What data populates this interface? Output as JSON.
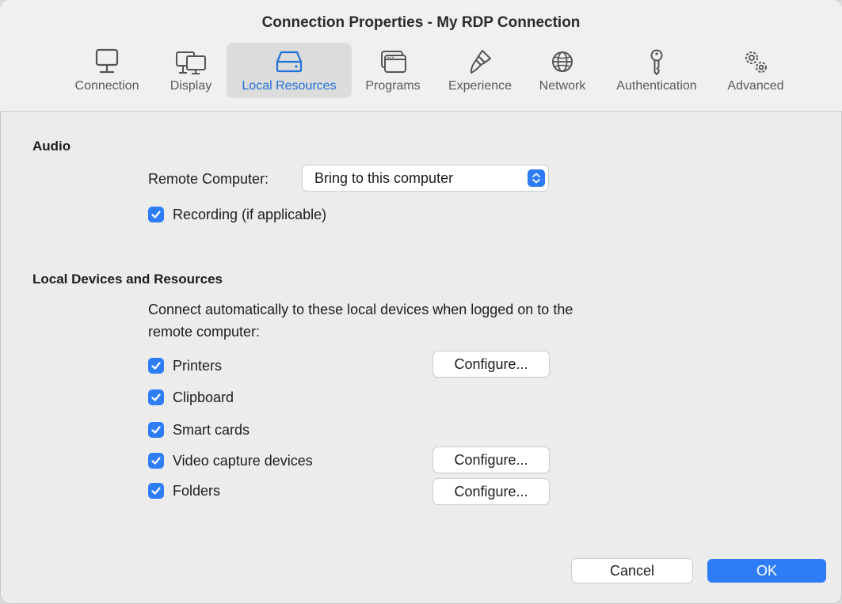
{
  "window": {
    "title": "Connection Properties - My RDP Connection"
  },
  "tabs": [
    {
      "label": "Connection",
      "icon": "monitor-icon"
    },
    {
      "label": "Display",
      "icon": "displays-icon"
    },
    {
      "label": "Local Resources",
      "icon": "drive-icon"
    },
    {
      "label": "Programs",
      "icon": "window-icon"
    },
    {
      "label": "Experience",
      "icon": "paintbrush-icon"
    },
    {
      "label": "Network",
      "icon": "globe-icon"
    },
    {
      "label": "Authentication",
      "icon": "key-icon"
    },
    {
      "label": "Advanced",
      "icon": "gears-icon"
    }
  ],
  "selected_tab": "Local Resources",
  "audio": {
    "heading": "Audio",
    "remote_label": "Remote Computer:",
    "remote_value": "Bring to this computer",
    "recording_label": "Recording (if applicable)",
    "recording_checked": true
  },
  "devices": {
    "heading": "Local Devices and Resources",
    "description_line1": "Connect automatically to these local devices when logged on to the",
    "description_line2": "remote computer:",
    "items": [
      {
        "label": "Printers",
        "checked": true,
        "configure": "Configure..."
      },
      {
        "label": "Clipboard",
        "checked": true
      },
      {
        "label": "Smart cards",
        "checked": true
      },
      {
        "label": "Video capture devices",
        "checked": true,
        "configure": "Configure..."
      },
      {
        "label": "Folders",
        "checked": true,
        "configure": "Configure..."
      }
    ]
  },
  "footer": {
    "cancel": "Cancel",
    "ok": "OK"
  },
  "colors": {
    "accent": "#2f7df6",
    "selected_tab_text": "#1f6fd8"
  }
}
